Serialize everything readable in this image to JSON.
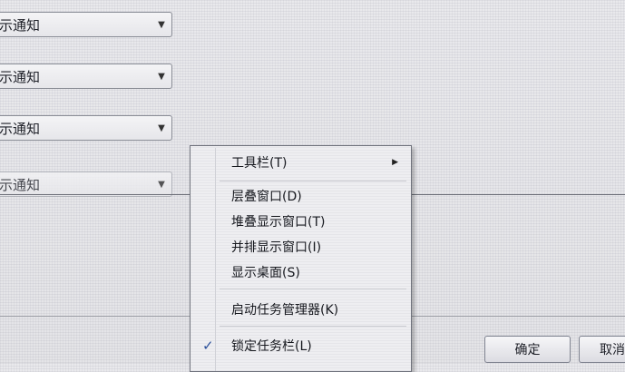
{
  "settings": {
    "dropdowns": [
      {
        "value": "示通知"
      },
      {
        "value": "示通知"
      },
      {
        "value": "示通知"
      },
      {
        "value": "示通知"
      }
    ]
  },
  "buttons": {
    "ok_label": "确定",
    "cancel_label": "取消"
  },
  "context_menu": {
    "items": [
      {
        "label": "工具栏(T)",
        "has_submenu": true,
        "submenu_glyph": "▶"
      },
      {
        "label": "层叠窗口(D)"
      },
      {
        "label": "堆叠显示窗口(T)"
      },
      {
        "label": "并排显示窗口(I)"
      },
      {
        "label": "显示桌面(S)"
      },
      {
        "label": "启动任务管理器(K)"
      },
      {
        "label": "锁定任务栏(L)",
        "checked": true,
        "check_glyph": "✓"
      }
    ]
  },
  "icons": {
    "dropdown_arrow": "▼"
  }
}
